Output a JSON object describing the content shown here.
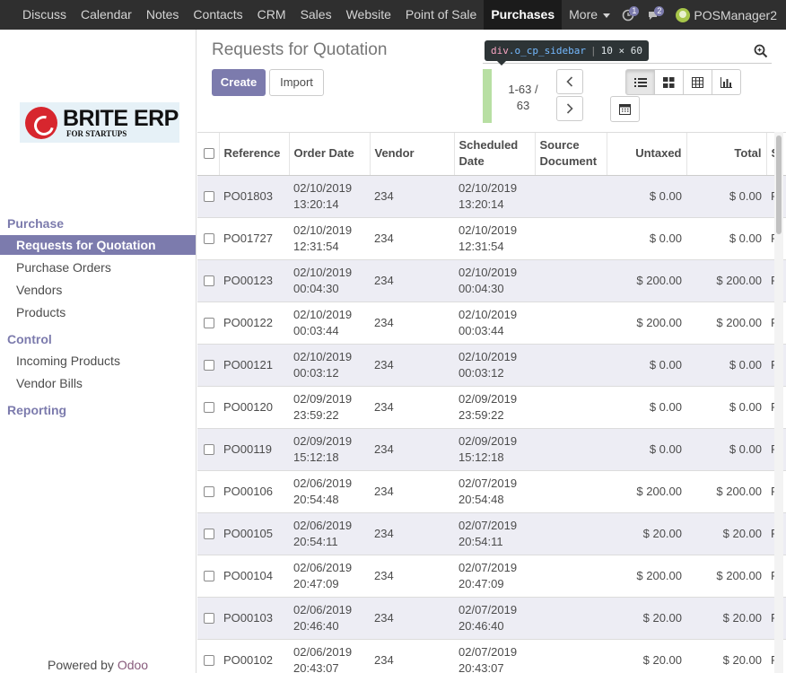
{
  "topbar": {
    "apps": [
      "Discuss",
      "Calendar",
      "Notes",
      "Contacts",
      "CRM",
      "Sales",
      "Website",
      "Point of Sale",
      "Purchases"
    ],
    "active_app": "Purchases",
    "more_label": "More",
    "activity_count": "1",
    "messages_count": "2",
    "user_name": "POSManager2"
  },
  "sidebar": {
    "logo_main": "BRITE ERP",
    "logo_sub": "FOR STARTUPS",
    "sections": [
      {
        "title": "Purchase",
        "items": [
          "Requests for Quotation",
          "Purchase Orders",
          "Vendors",
          "Products"
        ]
      },
      {
        "title": "Control",
        "items": [
          "Incoming Products",
          "Vendor Bills"
        ]
      },
      {
        "title": "Reporting",
        "items": []
      }
    ],
    "active_item": "Requests for Quotation",
    "powered_by": "Powered by",
    "powered_brand": "Odoo"
  },
  "control_panel": {
    "breadcrumb": "Requests for Quotation",
    "create_label": "Create",
    "import_label": "Import",
    "pager_line1": "1-63 /",
    "pager_line2": "63",
    "tooltip": {
      "tag": "div",
      "cls": ".o_cp_sidebar",
      "dims": "10 × 60"
    }
  },
  "table": {
    "columns": [
      "Reference",
      "Order Date",
      "Vendor",
      "Scheduled Date",
      "Source Document",
      "Untaxed",
      "Total",
      "S"
    ],
    "rows": [
      {
        "ref": "PO01803",
        "order_date": "02/10/2019",
        "order_time": "13:20:14",
        "vendor": "234",
        "sched_date": "02/10/2019",
        "sched_time": "13:20:14",
        "source": "",
        "untaxed": "$ 0.00",
        "total": "$ 0.00",
        "status": "R"
      },
      {
        "ref": "PO01727",
        "order_date": "02/10/2019",
        "order_time": "12:31:54",
        "vendor": "234",
        "sched_date": "02/10/2019",
        "sched_time": "12:31:54",
        "source": "",
        "untaxed": "$ 0.00",
        "total": "$ 0.00",
        "status": "R"
      },
      {
        "ref": "PO00123",
        "order_date": "02/10/2019",
        "order_time": "00:04:30",
        "vendor": "234",
        "sched_date": "02/10/2019",
        "sched_time": "00:04:30",
        "source": "",
        "untaxed": "$ 200.00",
        "total": "$ 200.00",
        "status": "R"
      },
      {
        "ref": "PO00122",
        "order_date": "02/10/2019",
        "order_time": "00:03:44",
        "vendor": "234",
        "sched_date": "02/10/2019",
        "sched_time": "00:03:44",
        "source": "",
        "untaxed": "$ 200.00",
        "total": "$ 200.00",
        "status": "R"
      },
      {
        "ref": "PO00121",
        "order_date": "02/10/2019",
        "order_time": "00:03:12",
        "vendor": "234",
        "sched_date": "02/10/2019",
        "sched_time": "00:03:12",
        "source": "",
        "untaxed": "$ 0.00",
        "total": "$ 0.00",
        "status": "R"
      },
      {
        "ref": "PO00120",
        "order_date": "02/09/2019",
        "order_time": "23:59:22",
        "vendor": "234",
        "sched_date": "02/09/2019",
        "sched_time": "23:59:22",
        "source": "",
        "untaxed": "$ 0.00",
        "total": "$ 0.00",
        "status": "R"
      },
      {
        "ref": "PO00119",
        "order_date": "02/09/2019",
        "order_time": "15:12:18",
        "vendor": "234",
        "sched_date": "02/09/2019",
        "sched_time": "15:12:18",
        "source": "",
        "untaxed": "$ 0.00",
        "total": "$ 0.00",
        "status": "R"
      },
      {
        "ref": "PO00106",
        "order_date": "02/06/2019",
        "order_time": "20:54:48",
        "vendor": "234",
        "sched_date": "02/07/2019",
        "sched_time": "20:54:48",
        "source": "",
        "untaxed": "$ 200.00",
        "total": "$ 200.00",
        "status": "R"
      },
      {
        "ref": "PO00105",
        "order_date": "02/06/2019",
        "order_time": "20:54:11",
        "vendor": "234",
        "sched_date": "02/07/2019",
        "sched_time": "20:54:11",
        "source": "",
        "untaxed": "$ 20.00",
        "total": "$ 20.00",
        "status": "R"
      },
      {
        "ref": "PO00104",
        "order_date": "02/06/2019",
        "order_time": "20:47:09",
        "vendor": "234",
        "sched_date": "02/07/2019",
        "sched_time": "20:47:09",
        "source": "",
        "untaxed": "$ 200.00",
        "total": "$ 200.00",
        "status": "R"
      },
      {
        "ref": "PO00103",
        "order_date": "02/06/2019",
        "order_time": "20:46:40",
        "vendor": "234",
        "sched_date": "02/07/2019",
        "sched_time": "20:46:40",
        "source": "",
        "untaxed": "$ 20.00",
        "total": "$ 20.00",
        "status": "R"
      },
      {
        "ref": "PO00102",
        "order_date": "02/06/2019",
        "order_time": "20:43:07",
        "vendor": "234",
        "sched_date": "02/07/2019",
        "sched_time": "20:43:07",
        "source": "",
        "untaxed": "$ 20.00",
        "total": "$ 20.00",
        "status": "R"
      }
    ]
  },
  "colors": {
    "accent": "#7c7bad",
    "topbar": "#2f2f2f",
    "row_stripe": "#ededf4",
    "pager_bar": "#b8dfa3",
    "odoo_brand": "#875a7b"
  }
}
